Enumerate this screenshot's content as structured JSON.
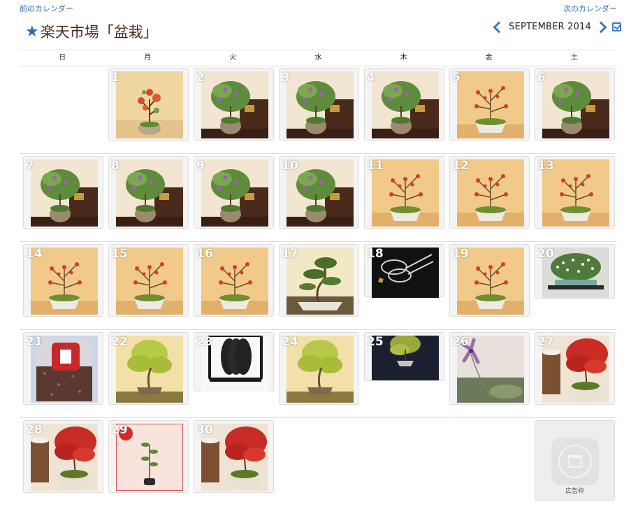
{
  "nav": {
    "prev": "前のカレンダー",
    "next": "次のカレンダー"
  },
  "header": {
    "star": "★",
    "title": "楽天市場「盆栽」",
    "month": "SEPTEMBER 2014"
  },
  "weekdays": [
    "日",
    "月",
    "火",
    "水",
    "木",
    "金",
    "土"
  ],
  "ad": {
    "label": "広告枠"
  },
  "colors": {
    "accent": "#3a78c2",
    "link": "#2a6ab7",
    "title": "#4a2a1c"
  },
  "days": [
    {
      "day": "1",
      "photo": "quince-small"
    },
    {
      "day": "2",
      "photo": "flowering-shrub"
    },
    {
      "day": "3",
      "photo": "flowering-shrub"
    },
    {
      "day": "4",
      "photo": "flowering-shrub"
    },
    {
      "day": "5",
      "photo": "quince-bonsai"
    },
    {
      "day": "6",
      "photo": "flowering-shrub"
    },
    {
      "day": "7",
      "photo": "flowering-shrub"
    },
    {
      "day": "8",
      "photo": "flowering-shrub"
    },
    {
      "day": "9",
      "photo": "flowering-shrub"
    },
    {
      "day": "10",
      "photo": "flowering-shrub"
    },
    {
      "day": "11",
      "photo": "quince-bonsai"
    },
    {
      "day": "12",
      "photo": "quince-bonsai"
    },
    {
      "day": "13",
      "photo": "quince-bonsai"
    },
    {
      "day": "14",
      "photo": "quince-bonsai"
    },
    {
      "day": "15",
      "photo": "quince-bonsai"
    },
    {
      "day": "16",
      "photo": "quince-bonsai"
    },
    {
      "day": "17",
      "photo": "pine-bonsai"
    },
    {
      "day": "18",
      "photo": "scissors"
    },
    {
      "day": "19",
      "photo": "quince-bonsai"
    },
    {
      "day": "20",
      "photo": "white-flower-tree"
    },
    {
      "day": "21",
      "photo": "soil-bag"
    },
    {
      "day": "22",
      "photo": "maple-green"
    },
    {
      "day": "23",
      "photo": "black-rack"
    },
    {
      "day": "24",
      "photo": "maple-green"
    },
    {
      "day": "25",
      "photo": "maple-dark"
    },
    {
      "day": "26",
      "photo": "purple-flower"
    },
    {
      "day": "27",
      "photo": "red-maple"
    },
    {
      "day": "28",
      "photo": "red-maple"
    },
    {
      "day": "29",
      "photo": "seedling"
    },
    {
      "day": "30",
      "photo": "red-maple"
    }
  ]
}
